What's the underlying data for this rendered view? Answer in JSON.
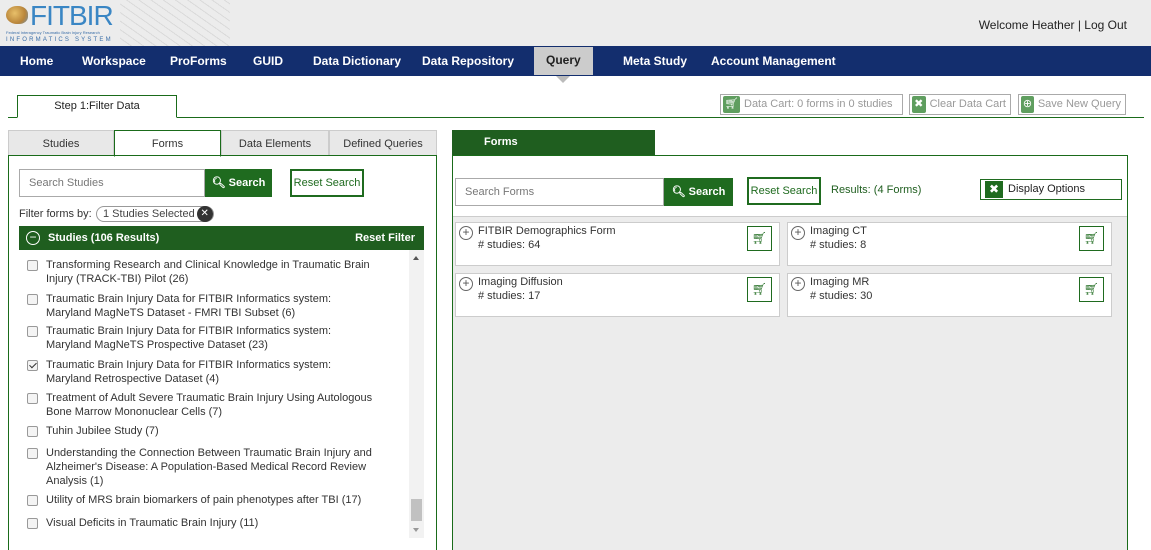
{
  "header": {
    "logo_text": "FITBIR",
    "logo_subtitle": "Federal Interagency Traumatic Brain Injury Research",
    "logo_subtitle2": "INFORMATICS SYSTEM",
    "welcome": "Welcome Heather | Log Out"
  },
  "nav": {
    "items": [
      "Home",
      "Workspace",
      "ProForms",
      "GUID",
      "Data Dictionary",
      "Data Repository",
      "Query",
      "Meta Study",
      "Account Management"
    ],
    "active": "Query"
  },
  "step_tab": "Step 1:Filter Data",
  "cart": {
    "data_cart": "Data Cart:  0  forms in  0  studies",
    "clear": "Clear Data Cart",
    "save": "Save New Query"
  },
  "left_tabs": [
    "Studies",
    "Forms",
    "Data Elements",
    "Defined Queries"
  ],
  "left_active_tab": "Forms",
  "left_search": {
    "placeholder": "Search Studies",
    "search_label": "Search",
    "reset_label": "Reset Search"
  },
  "filter": {
    "label": "Filter forms by:",
    "chip": "1 Studies Selected"
  },
  "studies_header": {
    "title": "Studies   (106 Results)",
    "reset_filter": "Reset Filter"
  },
  "studies": [
    {
      "label": "Transforming Research and Clinical Knowledge in Traumatic Brain Injury (TRACK-TBI) Pilot (26)",
      "checked": false
    },
    {
      "label": "Traumatic Brain Injury Data for FITBIR Informatics system: Maryland MagNeTS Dataset - FMRI TBI Subset (6)",
      "checked": false
    },
    {
      "label": "Traumatic Brain Injury Data for FITBIR Informatics system: Maryland MagNeTS Prospective Dataset (23)",
      "checked": false
    },
    {
      "label": "Traumatic Brain Injury Data for FITBIR Informatics system: Maryland Retrospective Dataset (4)",
      "checked": true
    },
    {
      "label": "Treatment of Adult Severe Traumatic Brain Injury Using Autologous Bone Marrow Mononuclear Cells (7)",
      "checked": false
    },
    {
      "label": "Tuhin Jubilee Study (7)",
      "checked": false
    },
    {
      "label": "Understanding the Connection Between Traumatic Brain Injury and Alzheimer's Disease: A Population-Based Medical Record Review Analysis (1)",
      "checked": false
    },
    {
      "label": "Utility of MRS brain biomarkers of pain phenotypes after TBI (17)",
      "checked": false
    },
    {
      "label": "Visual Deficits in Traumatic Brain Injury (11)",
      "checked": false
    }
  ],
  "right_tab": "Forms",
  "right_search": {
    "placeholder": "Search Forms",
    "search_label": "Search",
    "reset_label": "Reset Search",
    "results": "Results: (4 Forms)",
    "display_options": "Display Options"
  },
  "forms": [
    {
      "name": "FITBIR Demographics Form",
      "count": "# studies: 64"
    },
    {
      "name": "Imaging CT",
      "count": "# studies: 8"
    },
    {
      "name": "Imaging Diffusion",
      "count": "# studies: 17"
    },
    {
      "name": "Imaging MR",
      "count": "# studies: 30"
    }
  ],
  "colors": {
    "nav": "#132e6e",
    "green": "#1f5e1f",
    "logo": "#3a86c4"
  }
}
